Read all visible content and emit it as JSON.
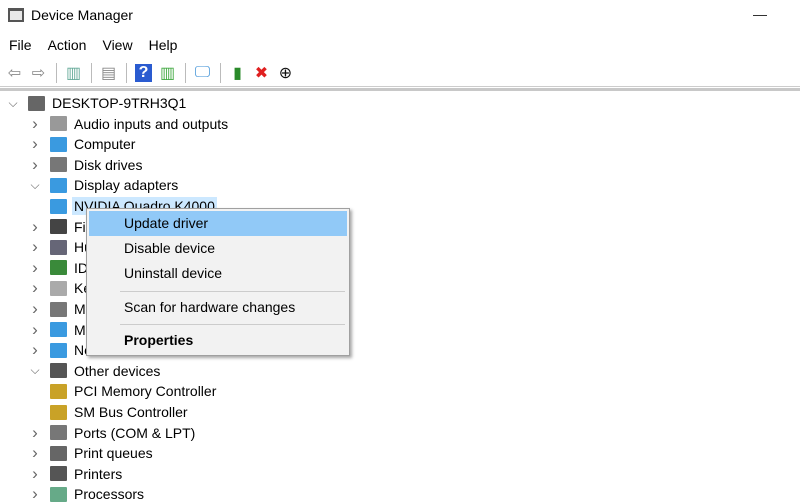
{
  "window": {
    "title": "Device Manager",
    "minimize": "—"
  },
  "menu": [
    "File",
    "Action",
    "View",
    "Help"
  ],
  "toolbar": [
    {
      "icon": "back-icon",
      "g": "⇦",
      "c": "#888"
    },
    {
      "icon": "forward-icon",
      "g": "⇨",
      "c": "#888"
    },
    {
      "sep": true
    },
    {
      "icon": "show-hide-console-tree-icon",
      "g": "▥",
      "c": "#6a9"
    },
    {
      "sep": true
    },
    {
      "icon": "properties-icon",
      "g": "▤",
      "c": "#888"
    },
    {
      "sep": true
    },
    {
      "icon": "help-icon",
      "g": "?",
      "c": "#fff",
      "bg": "#2a5bd0"
    },
    {
      "icon": "action-pane-icon",
      "g": "▥",
      "c": "#4a4"
    },
    {
      "sep": true
    },
    {
      "icon": "scan-hardware-icon",
      "g": "🖵",
      "c": "#3a8fd6"
    },
    {
      "sep": true
    },
    {
      "icon": "update-driver-icon",
      "g": "▮",
      "c": "#2a8a2a"
    },
    {
      "icon": "uninstall-icon",
      "g": "✖",
      "c": "#e02020"
    },
    {
      "icon": "disable-device-icon",
      "g": "⊕",
      "c": "#111"
    }
  ],
  "tree": [
    {
      "label": "DESKTOP-9TRH3Q1",
      "level": 0,
      "exp": "open",
      "color": "#666"
    },
    {
      "label": "Audio inputs and outputs",
      "level": 1,
      "exp": "closed",
      "color": "#999"
    },
    {
      "label": "Computer",
      "level": 1,
      "exp": "closed",
      "color": "#3a9ae0"
    },
    {
      "label": "Disk drives",
      "level": 1,
      "exp": "closed",
      "color": "#777"
    },
    {
      "label": "Display adapters",
      "level": 1,
      "exp": "open",
      "color": "#3a9ae0"
    },
    {
      "label": "NVIDIA Quadro K4000",
      "level": 2,
      "exp": "none",
      "color": "#3a9ae0",
      "selected": true
    },
    {
      "label": "Fi",
      "level": 1,
      "exp": "closed",
      "color": "#444"
    },
    {
      "label": "Hu",
      "level": 1,
      "exp": "closed",
      "color": "#667"
    },
    {
      "label": "ID",
      "level": 1,
      "exp": "closed",
      "color": "#3a8a3a"
    },
    {
      "label": "Ke",
      "level": 1,
      "exp": "closed",
      "color": "#aaa"
    },
    {
      "label": "M",
      "level": 1,
      "exp": "closed",
      "color": "#777"
    },
    {
      "label": "M",
      "level": 1,
      "exp": "closed",
      "color": "#3a9ae0"
    },
    {
      "label": "Ne",
      "level": 1,
      "exp": "closed",
      "color": "#3a9ae0"
    },
    {
      "label": "Other devices",
      "level": 1,
      "exp": "open",
      "color": "#555"
    },
    {
      "label": "PCI Memory Controller",
      "level": 2,
      "exp": "none",
      "color": "#c9a227"
    },
    {
      "label": "SM Bus Controller",
      "level": 2,
      "exp": "none",
      "color": "#c9a227"
    },
    {
      "label": "Ports (COM & LPT)",
      "level": 1,
      "exp": "closed",
      "color": "#777"
    },
    {
      "label": "Print queues",
      "level": 1,
      "exp": "closed",
      "color": "#666"
    },
    {
      "label": "Printers",
      "level": 1,
      "exp": "closed",
      "color": "#555"
    },
    {
      "label": "Processors",
      "level": 1,
      "exp": "closed",
      "color": "#6a8"
    }
  ],
  "context_menu": {
    "items": [
      "Update driver",
      "Disable device",
      "Uninstall device",
      "Scan for hardware changes",
      "Properties"
    ],
    "highlighted": "Update driver"
  }
}
